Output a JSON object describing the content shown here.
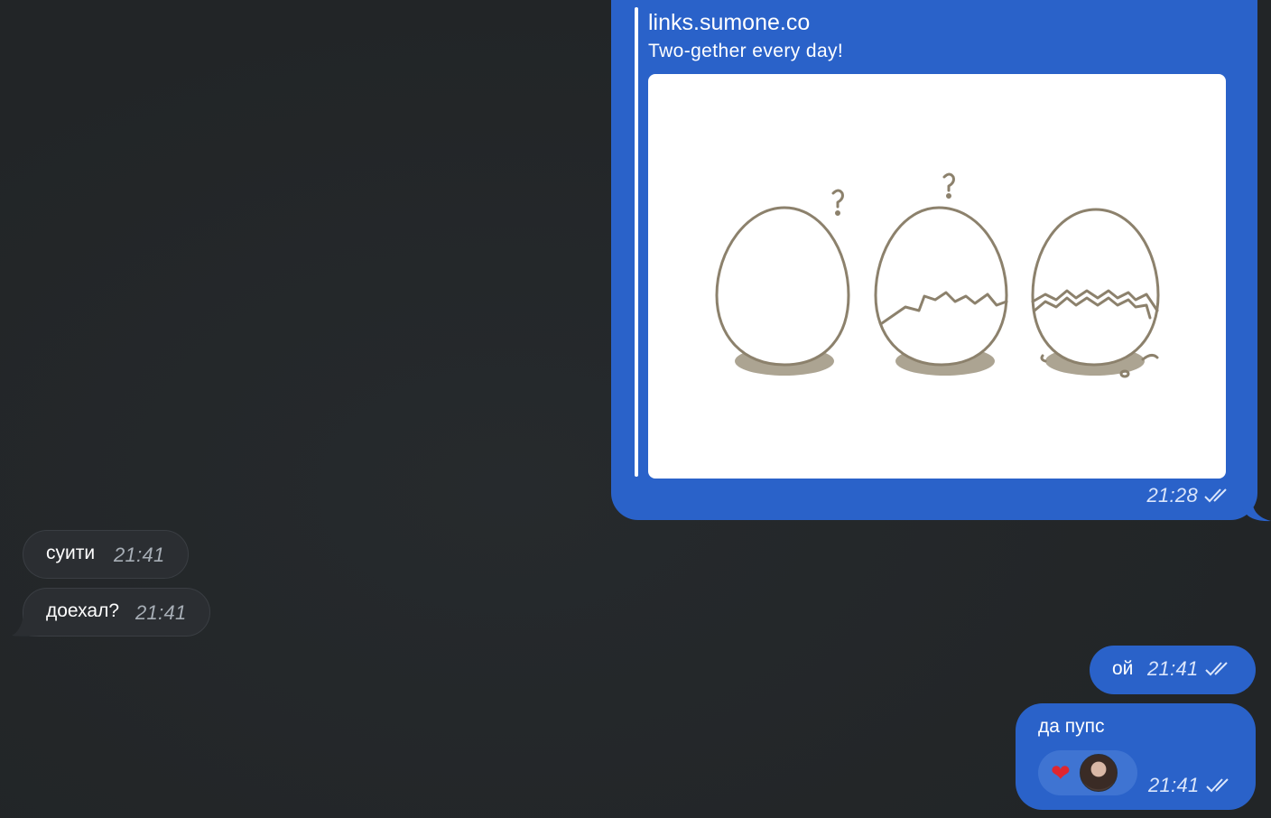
{
  "link_preview": {
    "site": "links.sumone.co",
    "description": "Two-gether every day!",
    "time": "21:28",
    "status_icon": "double-check-icon"
  },
  "incoming": [
    {
      "text": "суити",
      "time": "21:41"
    },
    {
      "text": "доехал?",
      "time": "21:41"
    }
  ],
  "outgoing": [
    {
      "text": "ой",
      "time": "21:41",
      "status_icon": "double-check-icon"
    },
    {
      "text": "да пупс",
      "time": "21:41",
      "status_icon": "double-check-icon",
      "reaction": {
        "emoji": "❤️",
        "icon": "heart-icon",
        "reactor_avatar": "user-avatar"
      }
    }
  ],
  "colors": {
    "background": "#232629",
    "outgoing_bubble": "#2a62c9",
    "incoming_bubble": "#2b2e32"
  }
}
